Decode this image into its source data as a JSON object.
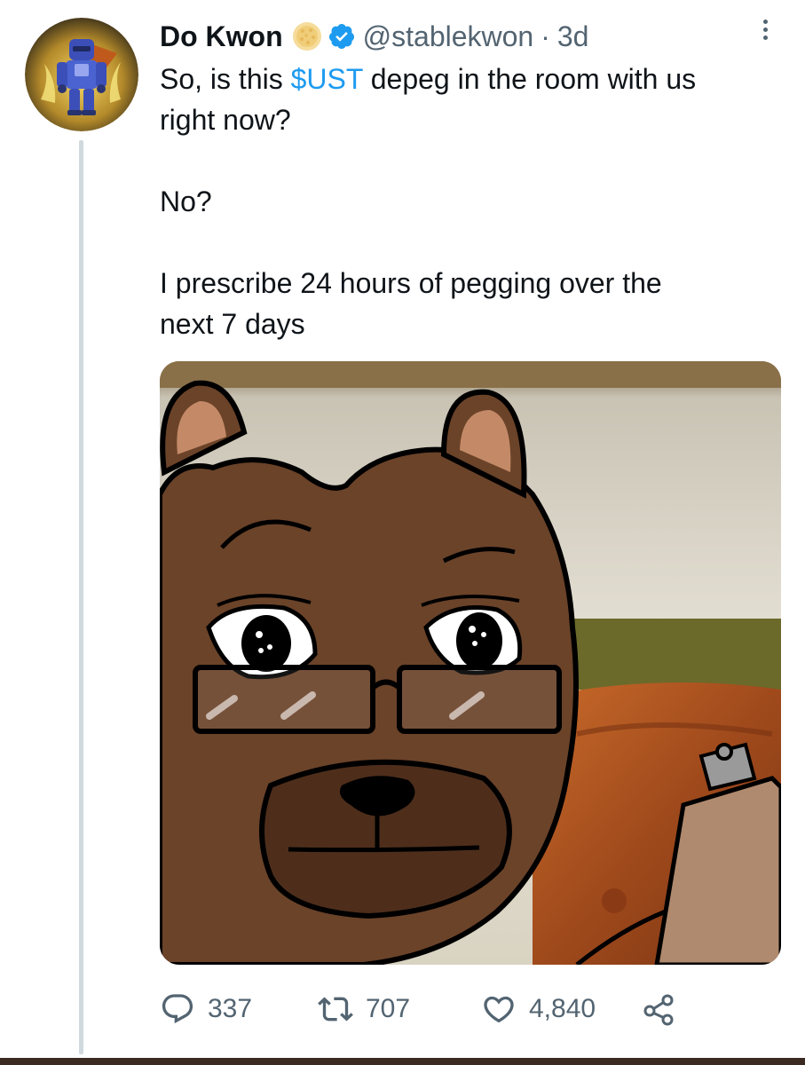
{
  "tweet": {
    "author_name": "Do Kwon",
    "handle": "@stablekwon",
    "separator": "·",
    "time_ago": "3d",
    "text": {
      "line1_prefix": "So, is this ",
      "cashtag": "$UST",
      "line1_suffix": " depeg in the room with us",
      "line2": "right now?",
      "para2": "No?",
      "para3_line1": "I prescribe 24 hours of pegging over the",
      "para3_line2": "next 7 days"
    }
  },
  "actions": {
    "replies": "337",
    "retweets": "707",
    "likes": "4,840"
  },
  "icons": {
    "reply": "reply-icon",
    "retweet": "retweet-icon",
    "like": "heart-icon",
    "share": "share-icon",
    "verified": "verified-badge-icon",
    "more": "more-options-icon"
  },
  "colors": {
    "cashtag": "#1d9bf0",
    "verified": "#1d9bf0",
    "muted_text": "#536471",
    "thread_line": "#cfd9de"
  }
}
